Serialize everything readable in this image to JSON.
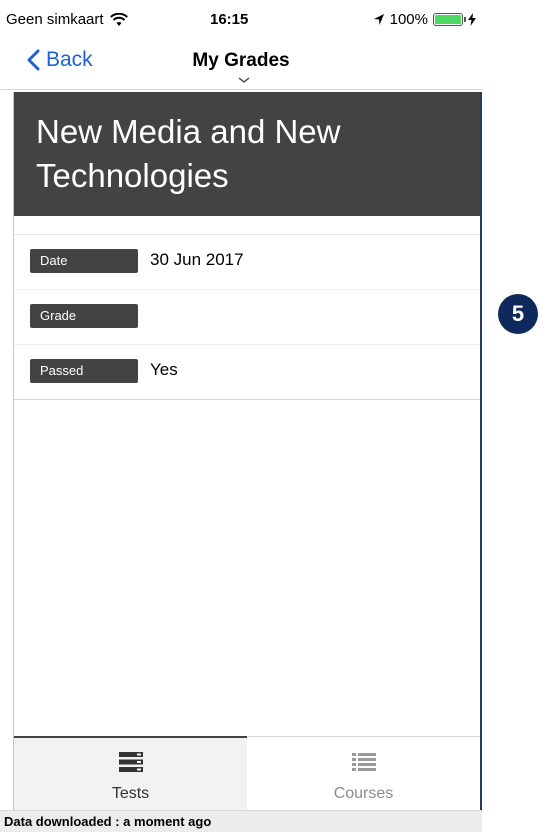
{
  "status_bar": {
    "carrier": "Geen simkaart",
    "time": "16:15",
    "battery": "100%"
  },
  "nav": {
    "back_label": "Back",
    "title": "My Grades"
  },
  "course": {
    "title": "New Media and New Technologies"
  },
  "details": [
    {
      "label": "Date",
      "value": "30 Jun 2017"
    },
    {
      "label": "Grade",
      "value": ""
    },
    {
      "label": "Passed",
      "value": "Yes"
    }
  ],
  "step_badge": "5",
  "tabs": [
    {
      "label": "Tests",
      "icon": "server-stack-icon",
      "active": true
    },
    {
      "label": "Courses",
      "icon": "list-icon",
      "active": false
    }
  ],
  "footer": {
    "status": "Data downloaded : a moment ago"
  },
  "colors": {
    "accent": "#1a62d6",
    "header_bg": "#434343",
    "badge_bg": "#10295c",
    "battery": "#4cd964"
  }
}
